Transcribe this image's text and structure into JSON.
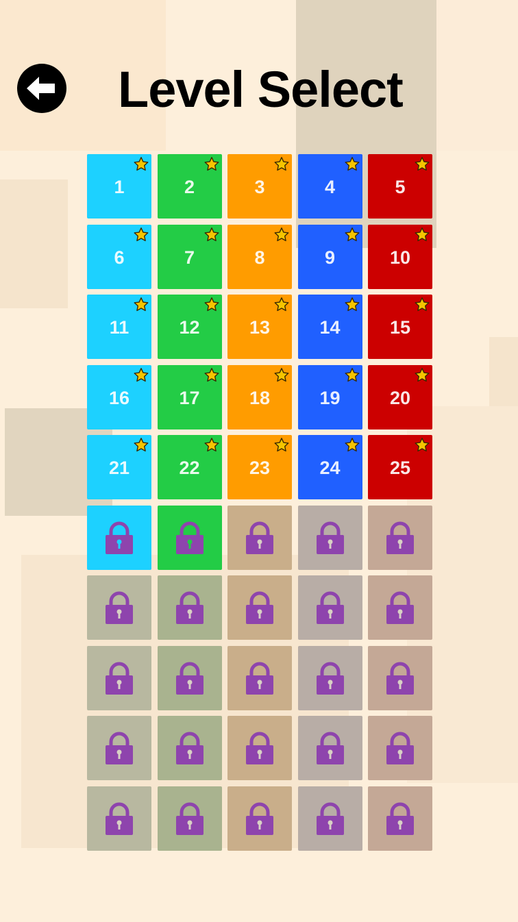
{
  "header": {
    "title": "Level Select",
    "back_icon": "arrow-left-icon"
  },
  "colors": {
    "background": "#fdefdb",
    "cyan": "#1dd1ff",
    "green": "#23cc46",
    "orange": "#ff9c00",
    "blue": "#2060ff",
    "red": "#cc0000",
    "star": "#f5c400",
    "lock": "#8e44ad"
  },
  "levels": [
    {
      "label": "1",
      "unlocked": true,
      "starred": true
    },
    {
      "label": "2",
      "unlocked": true,
      "starred": true
    },
    {
      "label": "3",
      "unlocked": true,
      "starred": true
    },
    {
      "label": "4",
      "unlocked": true,
      "starred": true
    },
    {
      "label": "5",
      "unlocked": true,
      "starred": true
    },
    {
      "label": "6",
      "unlocked": true,
      "starred": true
    },
    {
      "label": "7",
      "unlocked": true,
      "starred": true
    },
    {
      "label": "8",
      "unlocked": true,
      "starred": true
    },
    {
      "label": "9",
      "unlocked": true,
      "starred": true
    },
    {
      "label": "10",
      "unlocked": true,
      "starred": true
    },
    {
      "label": "11",
      "unlocked": true,
      "starred": true
    },
    {
      "label": "12",
      "unlocked": true,
      "starred": true
    },
    {
      "label": "13",
      "unlocked": true,
      "starred": true
    },
    {
      "label": "14",
      "unlocked": true,
      "starred": true
    },
    {
      "label": "15",
      "unlocked": true,
      "starred": true
    },
    {
      "label": "16",
      "unlocked": true,
      "starred": true
    },
    {
      "label": "17",
      "unlocked": true,
      "starred": true
    },
    {
      "label": "18",
      "unlocked": true,
      "starred": true
    },
    {
      "label": "19",
      "unlocked": true,
      "starred": true
    },
    {
      "label": "20",
      "unlocked": true,
      "starred": true
    },
    {
      "label": "21",
      "unlocked": true,
      "starred": true
    },
    {
      "label": "22",
      "unlocked": true,
      "starred": true
    },
    {
      "label": "23",
      "unlocked": true,
      "starred": true
    },
    {
      "label": "24",
      "unlocked": true,
      "starred": true
    },
    {
      "label": "25",
      "unlocked": true,
      "starred": true
    },
    {
      "label": "",
      "unlocked": false,
      "available": true
    },
    {
      "label": "",
      "unlocked": false,
      "available": true
    },
    {
      "label": "",
      "unlocked": false,
      "available": false
    },
    {
      "label": "",
      "unlocked": false,
      "available": false
    },
    {
      "label": "",
      "unlocked": false,
      "available": false
    },
    {
      "label": "",
      "unlocked": false,
      "available": false
    },
    {
      "label": "",
      "unlocked": false,
      "available": false
    },
    {
      "label": "",
      "unlocked": false,
      "available": false
    },
    {
      "label": "",
      "unlocked": false,
      "available": false
    },
    {
      "label": "",
      "unlocked": false,
      "available": false
    },
    {
      "label": "",
      "unlocked": false,
      "available": false
    },
    {
      "label": "",
      "unlocked": false,
      "available": false
    },
    {
      "label": "",
      "unlocked": false,
      "available": false
    },
    {
      "label": "",
      "unlocked": false,
      "available": false
    },
    {
      "label": "",
      "unlocked": false,
      "available": false
    },
    {
      "label": "",
      "unlocked": false,
      "available": false
    },
    {
      "label": "",
      "unlocked": false,
      "available": false
    },
    {
      "label": "",
      "unlocked": false,
      "available": false
    },
    {
      "label": "",
      "unlocked": false,
      "available": false
    },
    {
      "label": "",
      "unlocked": false,
      "available": false
    },
    {
      "label": "",
      "unlocked": false,
      "available": false
    },
    {
      "label": "",
      "unlocked": false,
      "available": false
    },
    {
      "label": "",
      "unlocked": false,
      "available": false
    },
    {
      "label": "",
      "unlocked": false,
      "available": false
    },
    {
      "label": "",
      "unlocked": false,
      "available": false
    }
  ]
}
